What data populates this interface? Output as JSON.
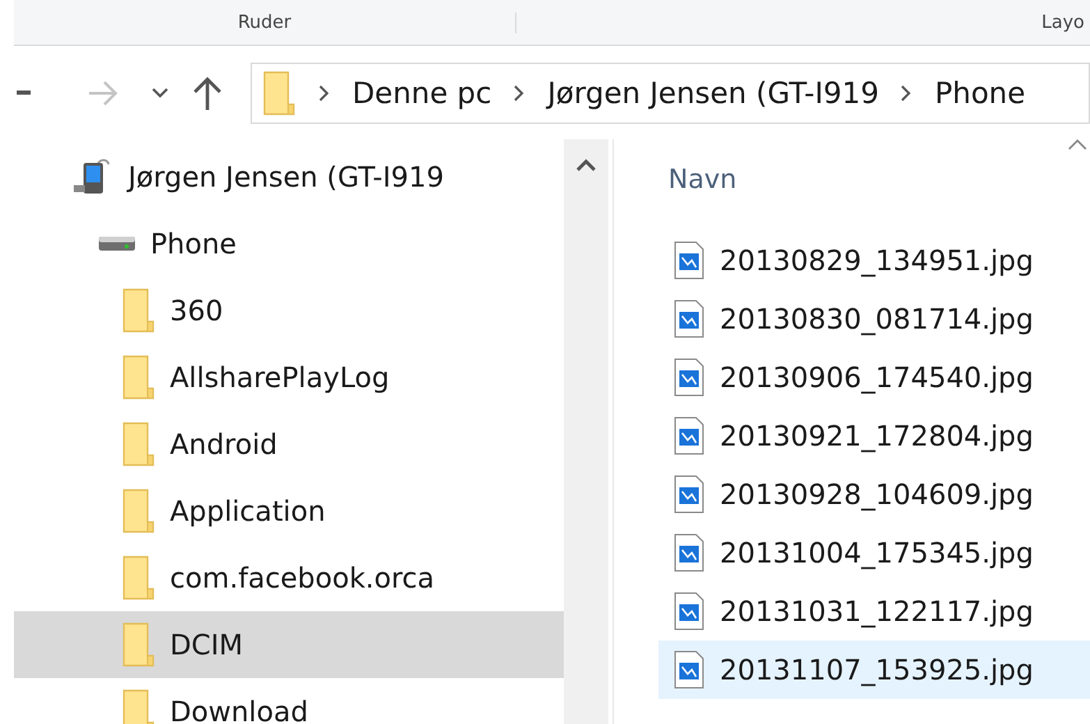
{
  "ribbon": {
    "groups": [
      "Ruder",
      "Layo"
    ]
  },
  "nav": {
    "buttons": [
      {
        "kind": "back",
        "disabled": false
      },
      {
        "kind": "forward",
        "disabled": true
      },
      {
        "kind": "recent",
        "disabled": false
      },
      {
        "kind": "up",
        "disabled": false
      }
    ],
    "breadcrumbs": [
      "Denne pc",
      "Jørgen Jensen (GT-I919",
      "Phone"
    ]
  },
  "tree": [
    {
      "label": "Jørgen Jensen (GT-I919",
      "kind": "device",
      "selected": false,
      "children": [
        {
          "label": "Phone",
          "kind": "drive",
          "selected": false,
          "children": [
            {
              "label": "360",
              "kind": "folder",
              "selected": false
            },
            {
              "label": "AllsharePlayLog",
              "kind": "folder",
              "selected": false
            },
            {
              "label": "Android",
              "kind": "folder",
              "selected": false
            },
            {
              "label": "Application",
              "kind": "folder",
              "selected": false
            },
            {
              "label": "com.facebook.orca",
              "kind": "folder",
              "selected": false
            },
            {
              "label": "DCIM",
              "kind": "folder",
              "selected": true
            },
            {
              "label": "Download",
              "kind": "folder",
              "selected": false
            }
          ]
        }
      ]
    }
  ],
  "files": {
    "columns": [
      "Navn"
    ],
    "rows": [
      {
        "name": "20130829_134951.jpg",
        "selected": false
      },
      {
        "name": "20130830_081714.jpg",
        "selected": false
      },
      {
        "name": "20130906_174540.jpg",
        "selected": false
      },
      {
        "name": "20130921_172804.jpg",
        "selected": false
      },
      {
        "name": "20130928_104609.jpg",
        "selected": false
      },
      {
        "name": "20131004_175345.jpg",
        "selected": false
      },
      {
        "name": "20131031_122117.jpg",
        "selected": false
      },
      {
        "name": "20131107_153925.jpg",
        "selected": true
      }
    ]
  }
}
